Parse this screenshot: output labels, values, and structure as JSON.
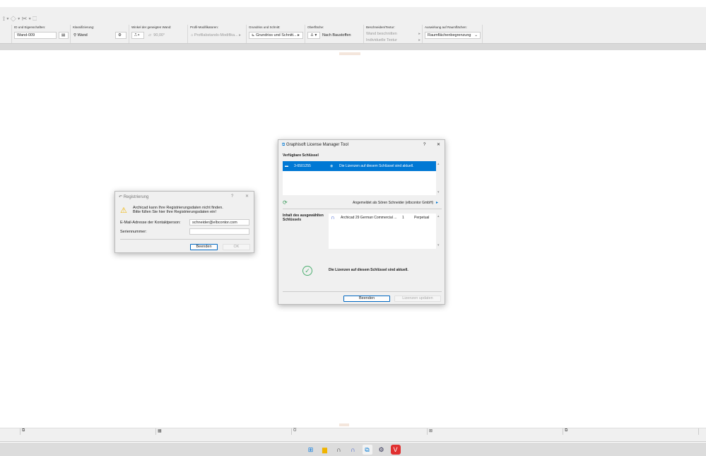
{
  "toolbar": {
    "quick_icons": "⟟ ▾ ◇ ▾ ✂ ▾ ⬚"
  },
  "infobox": {
    "id_label": "ID und Eigenschaften:",
    "id_value": "Wand-009",
    "class_label": "Klassifizierung:",
    "class_value": "Wand",
    "angle_label": "Winkel der geneigten Wand:",
    "angle_value": "90,00°",
    "profile_label": "Profil-Modifikatoren:",
    "profile_value": "Profilabstands-Modifika...",
    "plan_label": "Grundriss und Schnitt:",
    "plan_value": "Grundriss und Schnitt...",
    "surface_label": "Oberfläche:",
    "surface_value": "Nach Baustoffen",
    "trim_label": "Beschneiden/Textur:",
    "trim_item1": "Wand beschnitten",
    "trim_item2": "Individuelle Textur",
    "zone_label": "Auswirkung auf Raumflächen:",
    "zone_value": "Raumflächenbegrenzung"
  },
  "license_dialog": {
    "title": "Graphisoft License Manager Tool",
    "help": "?",
    "close": "✕",
    "available_keys_label": "Verfügbare Schlüssel",
    "key_id": "3-6501255",
    "key_status": "Die Lizenzen auf diesem Schlüssel sind aktuell.",
    "logged_in": "Angemeldet als Sören Schneider (elbcontor GmbH)",
    "content_label": "Inhalt des ausgewählten Schlüssels",
    "products": [
      {
        "name": "Archicad 29 German Commercial ...",
        "count": "1",
        "type": "Perpetual"
      }
    ],
    "status_message": "Die Lizenzen auf diesem Schlüssel sind aktuell.",
    "close_button": "Beenden",
    "update_button": "Lizenzen updaten",
    "selected_color": "#0078d4"
  },
  "registration_dialog": {
    "title": "Registrierung",
    "help": "?",
    "close": "✕",
    "message_line1": "Archicad kann Ihre Registrierungsdaten nicht finden.",
    "message_line2": "Bitte füllen Sie hier Ihre Registrierungsdaten ein!",
    "email_label": "E-Mail-Adresse der Kontaktperson:",
    "email_value": "schneider@elbcontor.com",
    "serial_label": "Seriennummer:",
    "serial_value": "",
    "quit_button": "Beenden",
    "ok_button": "OK"
  },
  "taskbar": {
    "icons": [
      "windows-start",
      "file-explorer",
      "archicad",
      "archicad-2",
      "license-manager",
      "settings",
      "vivaldi"
    ]
  }
}
